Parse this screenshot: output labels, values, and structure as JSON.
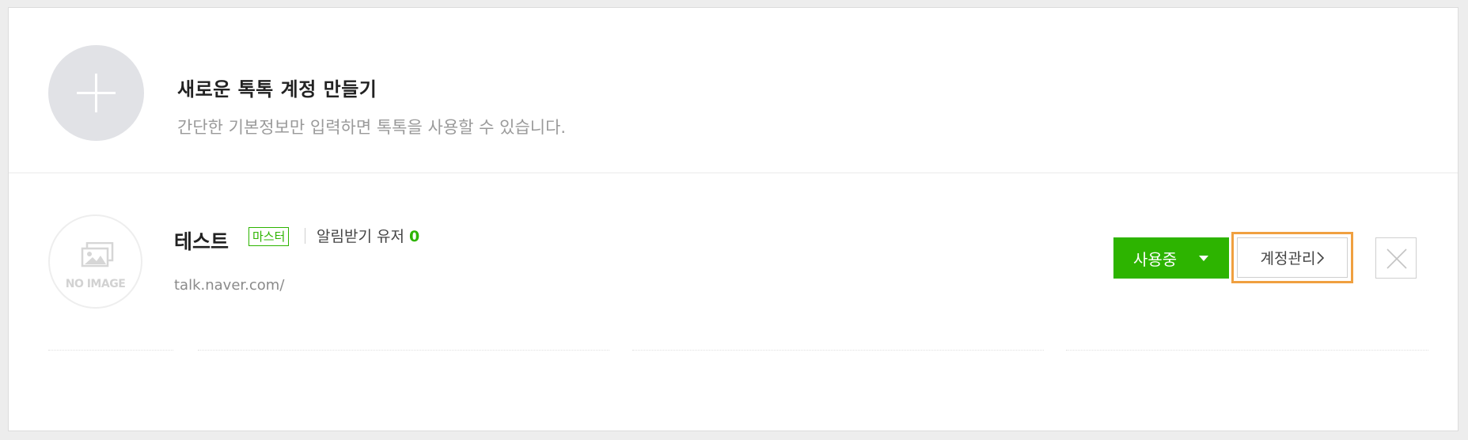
{
  "create": {
    "title": "새로운 톡톡 계정 만들기",
    "description": "간단한 기본정보만 입력하면 톡톡을 사용할 수 있습니다."
  },
  "account": {
    "avatar_text": "NO IMAGE",
    "name": "테스트",
    "role": "마스터",
    "notify_label": "알림받기 유저",
    "notify_count": "0",
    "url": "talk.naver.com/",
    "status_label": "사용중",
    "manage_label": "계정관리"
  },
  "colors": {
    "accent_green": "#2db400",
    "highlight_orange": "#f0a040"
  },
  "icons": {
    "plus": "plus-icon",
    "no_image": "image-placeholder-icon",
    "caret": "caret-down-icon",
    "arrow": "chevron-right-icon",
    "close": "close-icon"
  }
}
